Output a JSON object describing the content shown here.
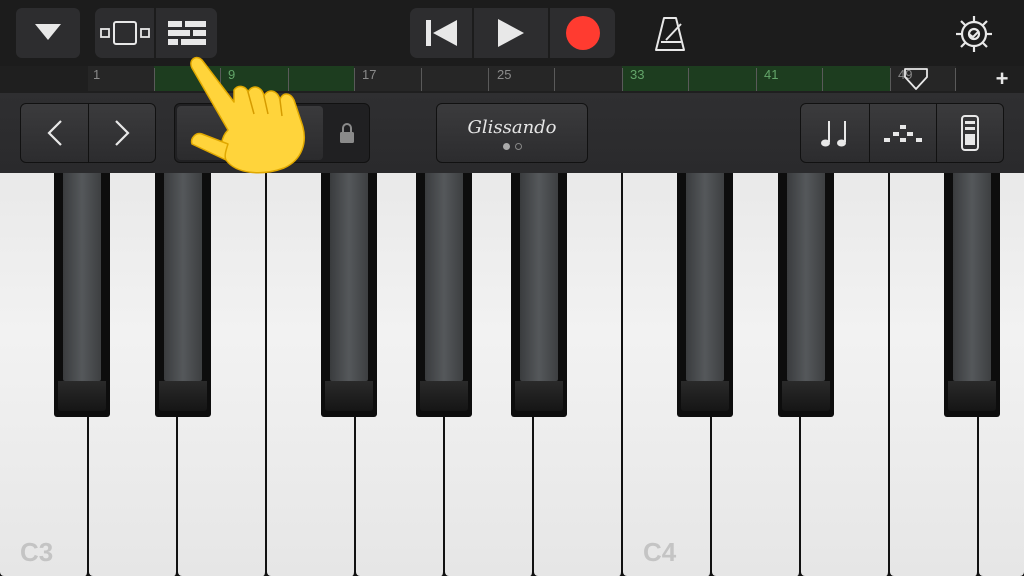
{
  "colors": {
    "record": "#ff3b30",
    "region_green": "#1d3d1f",
    "region_text": "#63a569",
    "toolbar_bg": "#1c1c1c",
    "button_bg": "#2d2d2f"
  },
  "toolbar": {
    "menu_icon": "triangle-down-icon",
    "view_icon": "browser-view-icon",
    "tracks_icon": "tracks-view-icon",
    "rewind_icon": "go-to-start-icon",
    "play_icon": "play-icon",
    "record_icon": "record-icon",
    "metronome_icon": "metronome-icon",
    "settings_icon": "settings-gear-icon"
  },
  "ruler": {
    "bar_numbers": [
      "1",
      "9",
      "17",
      "25",
      "33",
      "41",
      "49"
    ],
    "add_label": "+"
  },
  "controls": {
    "octave_down_icon": "chevron-left-icon",
    "octave_up_icon": "chevron-right-icon",
    "lock_icon": "lock-icon",
    "glissando_label": "Glissando",
    "glissando_page": 1,
    "glissando_pages": 2,
    "notes_icon": "notes-icon",
    "arpeggiator_icon": "arpeggiator-icon",
    "sustain_icon": "sustain-slider-icon"
  },
  "keyboard": {
    "labels": [
      "C3",
      "C4"
    ]
  },
  "overlay": {
    "hand_icon": "pointing-hand-icon"
  }
}
